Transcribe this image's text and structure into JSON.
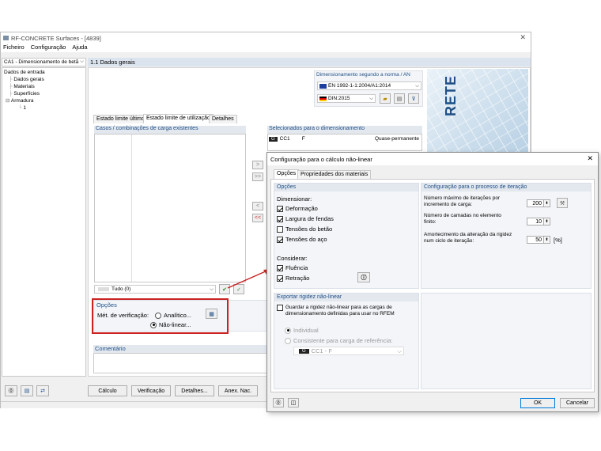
{
  "main": {
    "title": "RF-CONCRETE Surfaces - [4839]",
    "menu": [
      "Ficheiro",
      "Configuração",
      "Ajuda"
    ],
    "case_select": "CA1 - Dimensionamento de betã",
    "section_title": "1.1 Dados gerais",
    "tree": {
      "root": "Dados de entrada",
      "items": [
        "Dados gerais",
        "Materiais",
        "Superfícies",
        "Armadura"
      ],
      "sub": "1"
    },
    "norm": {
      "label": "Dimensionamento segundo a norma / AN",
      "standard": "EN 1992-1-1:2004/A1:2014",
      "annex": "DIN:2015"
    },
    "tabs": [
      "Estado limite último",
      "Estado limite de utilização",
      "Detalhes"
    ],
    "existing_label": "Casos / combinações de carga existentes",
    "selected_label": "Selecionados para o dimensionamento",
    "selected_row": {
      "tag": "G",
      "name": "CC1",
      "type": "F",
      "desc": "Quase-permanente"
    },
    "filter": "Tudo (0)",
    "options": {
      "header": "Opções",
      "method_label": "Mét. de verificação:",
      "analytic": "Analítico...",
      "nonlinear": "Não-linear..."
    },
    "comment_label": "Comentário",
    "bottom_buttons": [
      "Cálculo",
      "Verificação",
      "Detalhes...",
      "Anex. Nac."
    ],
    "logo_text": "RETE"
  },
  "dialog": {
    "title": "Configuração para o cálculo não-linear",
    "tabs": [
      "Opções",
      "Propriedades dos materiais"
    ],
    "options": {
      "header": "Opções",
      "design_label": "Dimensionar:",
      "design_items": [
        {
          "label": "Deformação",
          "checked": true
        },
        {
          "label": "Largura de fendas",
          "checked": true
        },
        {
          "label": "Tensões do betão",
          "checked": false
        },
        {
          "label": "Tensões do aço",
          "checked": true
        }
      ],
      "consider_label": "Considerar:",
      "consider_items": [
        {
          "label": "Fluência",
          "checked": true
        },
        {
          "label": "Retração",
          "checked": true
        }
      ]
    },
    "iteration": {
      "header": "Configuração para o processo de iteração",
      "max_iter_label": "Número máximo de iterações por incremento de carga:",
      "max_iter": "200",
      "layers_label": "Número de camadas no elemento finito:",
      "layers": "10",
      "damping_label": "Amortecimento da alteração da rigidez num ciclo de iteração:",
      "damping": "50",
      "damping_unit": "[%]"
    },
    "export": {
      "header": "Exportar rigidez não-linear",
      "save_label": "Guardar a rigidez não-linear para as cargas de dimensionamento definidas para usar no RFEM",
      "individual": "Individual",
      "consistent": "Consistente para carga de referência:",
      "ref_tag": "G",
      "ref_value": "CC1 - F"
    },
    "ok": "OK",
    "cancel": "Cancelar"
  },
  "colors": {
    "accent": "#1f4f86",
    "highlight": "#cc2222"
  }
}
